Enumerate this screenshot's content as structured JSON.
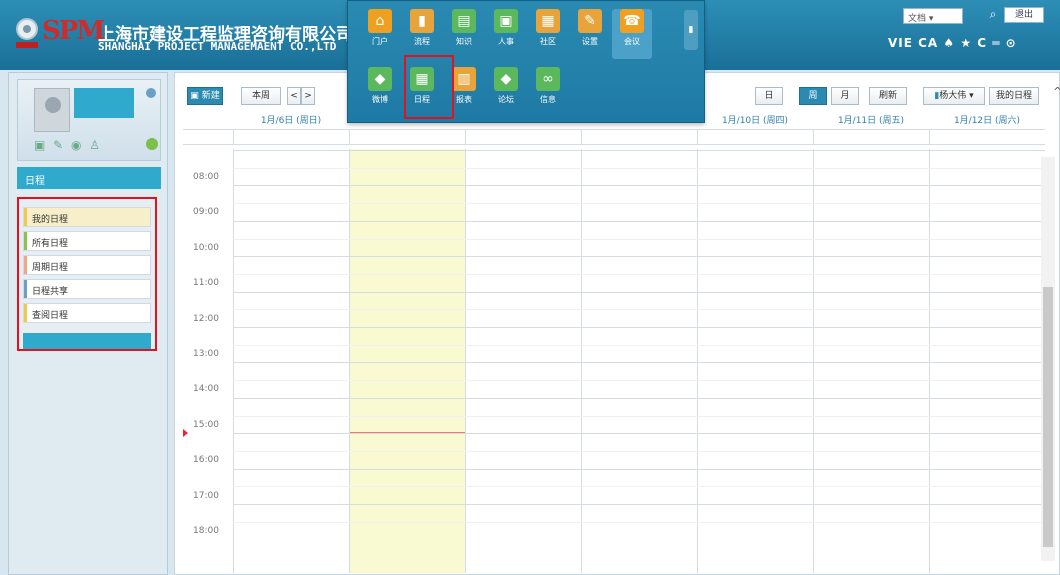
{
  "header": {
    "logo_text": "SPM",
    "company_cn": "上海市建设工程监理咨询有限公司",
    "company_en": "SHANGHAI PROJECT MANAGEMAENT CO.,LTD",
    "doc_dropdown": "文档 ▾",
    "logout": "退出",
    "quick_icons": "VIE CA ♠ ★ C ═ ⊙"
  },
  "app_menu": {
    "row1": [
      {
        "label": "门户",
        "icon": "home-icon",
        "glyph": "⌂",
        "color": "#f0a020"
      },
      {
        "label": "流程",
        "icon": "chart-icon",
        "glyph": "▮",
        "color": "#e8a43a"
      },
      {
        "label": "知识",
        "icon": "book-icon",
        "glyph": "▤",
        "color": "#5cb85c"
      },
      {
        "label": "人事",
        "icon": "people-icon",
        "glyph": "▣",
        "color": "#5cb85c"
      },
      {
        "label": "社区",
        "icon": "community-icon",
        "glyph": "▦",
        "color": "#e8a43a"
      },
      {
        "label": "设置",
        "icon": "settings-icon",
        "glyph": "✎",
        "color": "#e8a43a"
      },
      {
        "label": "会议",
        "icon": "phone-icon",
        "glyph": "☎",
        "color": "#f0a020"
      }
    ],
    "row2": [
      {
        "label": "微博",
        "icon": "tag-icon",
        "glyph": "◆",
        "color": "#5cb85c"
      },
      {
        "label": "日程",
        "icon": "calendar-icon",
        "glyph": "▦",
        "color": "#5cb85c"
      },
      {
        "label": "报表",
        "icon": "report-icon",
        "glyph": "▥",
        "color": "#e8a43a"
      },
      {
        "label": "论坛",
        "icon": "forum-icon",
        "glyph": "◆",
        "color": "#5cb85c"
      },
      {
        "label": "信息",
        "icon": "link-icon",
        "glyph": "∞",
        "color": "#5cb85c"
      }
    ]
  },
  "sidebar": {
    "section_title": "日程",
    "items": [
      {
        "label": "我的日程",
        "active": true,
        "color": "#f0c84a"
      },
      {
        "label": "所有日程",
        "active": false,
        "color": "#8bc34a"
      },
      {
        "label": "周期日程",
        "active": false,
        "color": "#f4a582"
      },
      {
        "label": "日程共享",
        "active": false,
        "color": "#6aa0c8"
      },
      {
        "label": "查阅日程",
        "active": false,
        "color": "#f0c84a"
      }
    ]
  },
  "toolbar": {
    "new_label": "新建",
    "this_week": "本周",
    "prev": "<",
    "next": ">",
    "view_day": "日",
    "view_week": "周",
    "view_month": "月",
    "refresh": "刷新",
    "user_dropdown": "杨大伟 ▾",
    "my_schedule": "我的日程"
  },
  "calendar": {
    "days": [
      "1月/6日 (周日)",
      "",
      "",
      "",
      "1月/10日 (周四)",
      "1月/11日 (周五)",
      "1月/12日 (周六)"
    ],
    "times": [
      "08:00",
      "09:00",
      "10:00",
      "11:00",
      "12:00",
      "13:00",
      "14:00",
      "15:00",
      "16:00",
      "17:00",
      "18:00"
    ]
  }
}
